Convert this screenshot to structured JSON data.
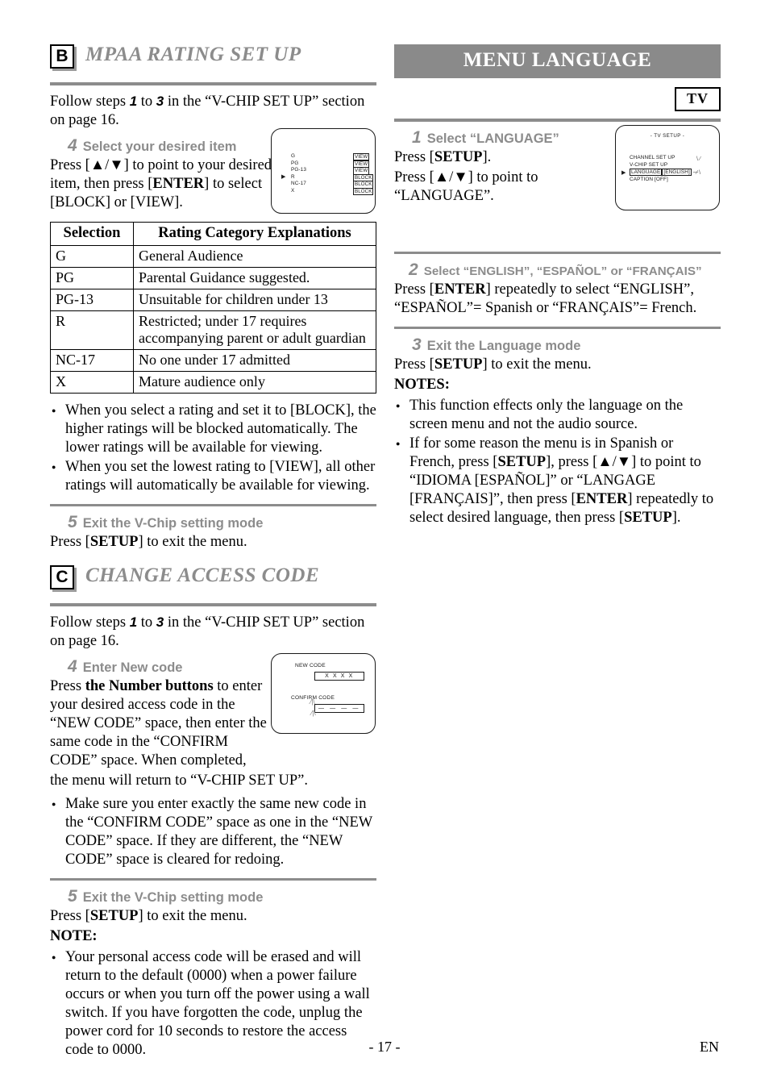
{
  "sections": {
    "mpaa": {
      "badge": "B",
      "title": "MPAA RATING SET UP",
      "intro_pre": "Follow steps ",
      "intro_num1": "1",
      "intro_mid": " to ",
      "intro_num2": "3",
      "intro_post": " in the “V-CHIP SET UP” section on page 16.",
      "step4_num": "4",
      "step4_label": "Select your desired item",
      "step4_body": "Press [▲/▼] to point to your desired item, then press [ENTER] to select [BLOCK] or [VIEW].",
      "step5_num": "5",
      "step5_label": "Exit the V-Chip setting mode",
      "step5_body": "Press [SETUP] to exit the menu.",
      "notes": [
        "When you select a rating and set it to [BLOCK], the higher ratings will be blocked automatically. The lower ratings will be available for viewing.",
        "When you set the lowest rating to [VIEW], all other ratings will automatically be available for viewing."
      ],
      "table": {
        "headers": [
          "Selection",
          "Rating Category Explanations"
        ],
        "rows": [
          [
            "G",
            "General Audience"
          ],
          [
            "PG",
            "Parental Guidance suggested."
          ],
          [
            "PG-13",
            "Unsuitable for children under 13"
          ],
          [
            "R",
            "Restricted; under 17 requires accompanying parent or adult guardian"
          ],
          [
            "NC-17",
            "No one under 17 admitted"
          ],
          [
            "X",
            "Mature audience only"
          ]
        ]
      },
      "screen": {
        "rows": [
          {
            "name": "G",
            "value": "VIEW",
            "cursor": false
          },
          {
            "name": "PG",
            "value": "VIEW",
            "cursor": false
          },
          {
            "name": "PG-13",
            "value": "VIEW",
            "cursor": false
          },
          {
            "name": "R",
            "value": "BLOCK",
            "cursor": true
          },
          {
            "name": "NC-17",
            "value": "BLOCK",
            "cursor": false
          },
          {
            "name": "X",
            "value": "BLOCK",
            "cursor": false
          }
        ],
        "cursor_glyph": "▶"
      }
    },
    "access_code": {
      "badge": "C",
      "title": "CHANGE ACCESS CODE",
      "intro_pre": "Follow steps ",
      "intro_num1": "1",
      "intro_mid": " to ",
      "intro_num2": "3",
      "intro_post": " in the “V-CHIP SET UP” section on page 16.",
      "step4_num": "4",
      "step4_label": "Enter New code",
      "step4_body": "Press the Number buttons to enter your desired access code in the “NEW CODE” space, then enter the same code in the “CONFIRM CODE” space. When completed, the menu will return to “V-CHIP SET UP”.",
      "step5_num": "5",
      "step5_label": "Exit the V-Chip setting mode",
      "step5_body": "Press [SETUP] to exit the menu.",
      "bullet": "Make sure you enter exactly the same new code in the “CONFIRM CODE” space as one in the “NEW CODE” space. If they are different, the “NEW CODE” space is cleared for redoing.",
      "note_heading": "NOTE:",
      "note": "Your personal access code will be erased and will return to the default (0000) when a power failure occurs or when you turn off the power using a wall switch. If you have forgotten the code, unplug the power cord for 10 seconds to restore the access code to 0000.",
      "screen": {
        "new_code_label": "NEW CODE",
        "new_code_value": "X X X X",
        "confirm_code_label": "CONFIRM CODE",
        "confirm_code_value": "—  —  —  —"
      }
    },
    "menu_language": {
      "banner_title": "MENU LANGUAGE",
      "tv_tag": "TV",
      "step1_num": "1",
      "step1_label": "Select “LANGUAGE”",
      "step1_body_a": "Press [SETUP].",
      "step1_body_b": "Press [▲/▼] to point to “LANGUAGE”.",
      "step2_num": "2",
      "step2_label": "Select “ENGLISH”, “ESPAÑOL” or “FRANÇAIS”",
      "step2_body": "Press [ENTER] repeatedly to select “ENGLISH”, “ESPAÑOL”= Spanish or “FRANÇAIS”= French.",
      "step3_num": "3",
      "step3_label": "Exit the Language mode",
      "step3_body": "Press [SETUP] to exit the menu.",
      "notes_heading": "NOTES:",
      "notes": [
        "This function effects only the language on the screen menu and not the audio source.",
        "If for some reason the menu is in Spanish or French, press [SETUP], press [▲/▼] to point to “IDIOMA [ESPAÑOL]” or “LANGAGE [FRANÇAIS]”, then press [ENTER] repeatedly to select desired language, then press [SETUP]."
      ],
      "screen": {
        "title": "- TV SETUP -",
        "items": [
          {
            "label": "CHANNEL SET UP",
            "value": "",
            "cursor": false
          },
          {
            "label": "V-CHIP SET UP",
            "value": "",
            "cursor": false
          },
          {
            "label": "LANGUAGE",
            "value": "[ENGLISH]",
            "cursor": true
          },
          {
            "label": "CAPTION",
            "value": "[OFF]",
            "cursor": false
          }
        ],
        "cursor_glyph": "▶"
      }
    }
  },
  "footer": {
    "page_number": "- 17 -",
    "language_code": "EN"
  },
  "colors": {
    "banner_gray": "#8a8a8a",
    "rule_gray": "#8c8c8c",
    "heading_gray": "#8c8c8c",
    "text_black": "#000000"
  }
}
